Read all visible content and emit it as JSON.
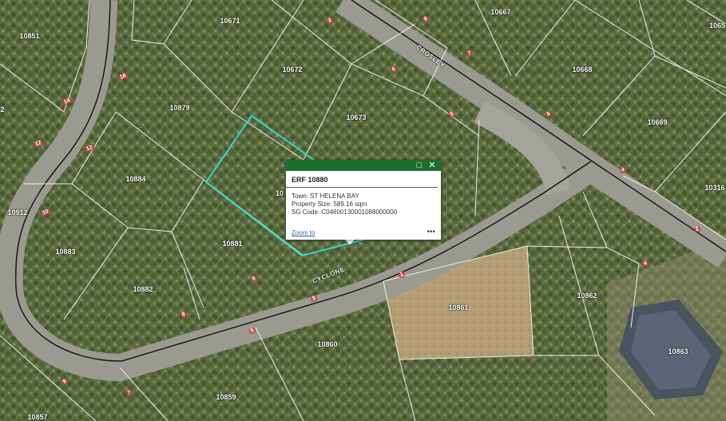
{
  "parcels": [
    {
      "id": "10851"
    },
    {
      "id": "10671"
    },
    {
      "id": "10672"
    },
    {
      "id": "10667"
    },
    {
      "id": "10668"
    },
    {
      "id": "10879"
    },
    {
      "id": "10673"
    },
    {
      "id": "10669"
    },
    {
      "id": "10884"
    },
    {
      "id": "10316"
    },
    {
      "id": "10912"
    },
    {
      "id": "10883"
    },
    {
      "id": "10881"
    },
    {
      "id": "10882"
    },
    {
      "id": "10861"
    },
    {
      "id": "10862"
    },
    {
      "id": "10860"
    },
    {
      "id": "10863"
    },
    {
      "id": "10859"
    },
    {
      "id": "10857"
    },
    {
      "id": "1065"
    },
    {
      "id": "2"
    }
  ],
  "roads": {
    "crosley": "CROSLEY",
    "cyclone": "CYCLONE"
  },
  "stand_numbers": [
    "16",
    "14",
    "12",
    "10",
    "12",
    "9",
    "7",
    "6",
    "3",
    "6",
    "5",
    "4",
    "2",
    "8",
    "6",
    "4",
    "1",
    "3",
    "5",
    "7",
    "9"
  ],
  "popup": {
    "title": "ERF 10880",
    "town_label": "Town:",
    "town_value": "ST HELENA BAY",
    "size_label": "Property Size:",
    "size_value": "589.16 sqm",
    "sg_label": "SG Code:",
    "sg_value": "C04600130001088000000",
    "zoom_link": "Zoom to",
    "more": "•••",
    "maximize_icon": "□",
    "close_icon": "✕",
    "partial_label": "10"
  },
  "colors": {
    "popup_header": "#1f6f2c",
    "selection_outline": "#33d6d0",
    "road_surface": "#9a9a90",
    "parcel_line": "#f2f2f2"
  }
}
